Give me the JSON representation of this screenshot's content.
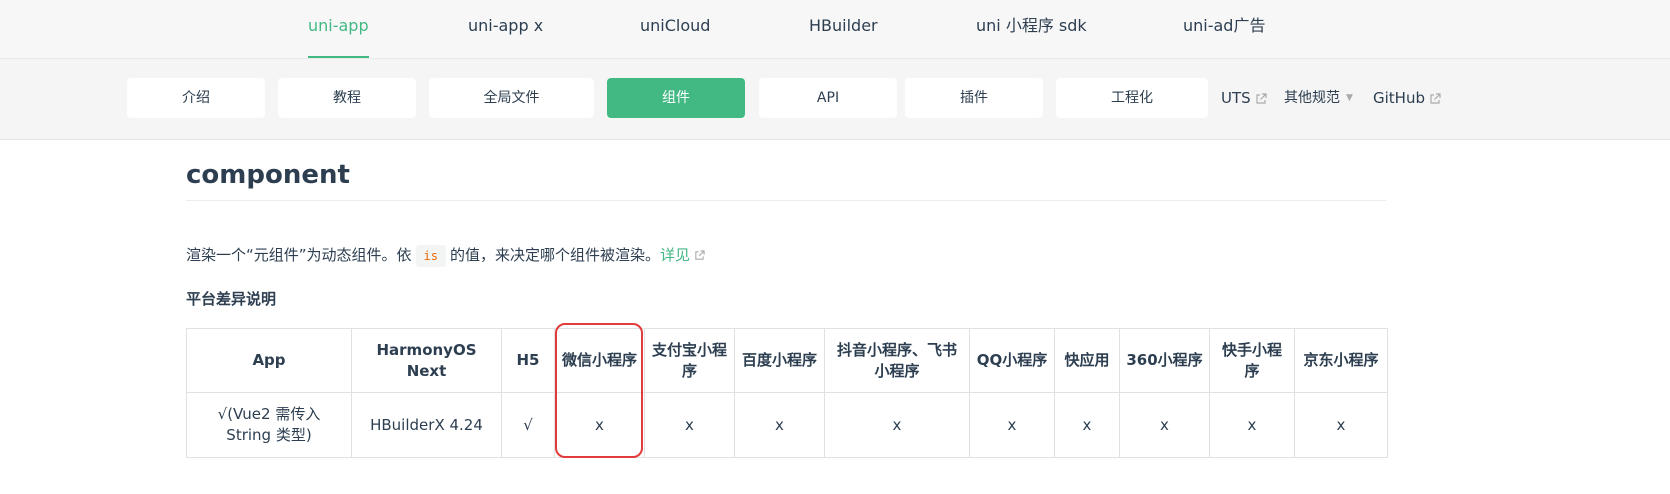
{
  "topnav": {
    "items": [
      "uni-app",
      "uni-app x",
      "uniCloud",
      "HBuilder",
      "uni 小程序 sdk",
      "uni-ad广告"
    ]
  },
  "subnav": {
    "pills": [
      "介绍",
      "教程",
      "全局文件",
      "组件",
      "API",
      "插件",
      "工程化"
    ],
    "uts": "UTS",
    "other": "其他规范",
    "github": "GitHub"
  },
  "content": {
    "title": "component",
    "desc_before": "渲染一个“元组件”为动态组件。依",
    "desc_code": "is",
    "desc_after": "的值，来决定哪个组件被渲染。",
    "desc_link": "详见",
    "section_title": "平台差异说明"
  },
  "table": {
    "headers": [
      "App",
      "HarmonyOS Next",
      "H5",
      "微信小程序",
      "支付宝小程序",
      "百度小程序",
      "抖音小程序、飞书小程序",
      "QQ小程序",
      "快应用",
      "360小程序",
      "快手小程序",
      "京东小程序"
    ],
    "row": [
      "√(Vue2 需传入 String 类型)",
      "HBuilderX 4.24",
      "√",
      "x",
      "x",
      "x",
      "x",
      "x",
      "x",
      "x",
      "x",
      "x"
    ]
  },
  "colors": {
    "accent": "#42b983",
    "highlight": "#e23b3b",
    "code": "#e96900"
  }
}
